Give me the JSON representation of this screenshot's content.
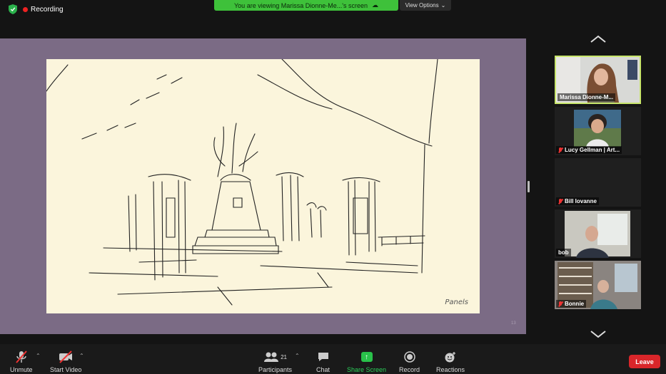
{
  "top": {
    "recording_label": "Recording",
    "banner_text": "You are viewing Marissa Dionne-Me...'s screen",
    "view_options_label": "View Options"
  },
  "share": {
    "slide_caption": "Panels",
    "page_number": "13"
  },
  "participants": [
    {
      "name": "Marissa Dionne-M...",
      "muted": false,
      "active": true
    },
    {
      "name": "Lucy Gellman | Art...",
      "muted": true,
      "active": false
    },
    {
      "name": "Bill Iovanne",
      "muted": true,
      "active": false
    },
    {
      "name": "bob",
      "muted": false,
      "active": false
    },
    {
      "name": "Bonnie",
      "muted": true,
      "active": false
    }
  ],
  "toolbar": {
    "unmute_label": "Unmute",
    "start_video_label": "Start Video",
    "participants_label": "Participants",
    "participants_count": "21",
    "chat_label": "Chat",
    "share_screen_label": "Share Screen",
    "record_label": "Record",
    "reactions_label": "Reactions",
    "leave_label": "Leave"
  },
  "colors": {
    "banner_green": "#3ec13a",
    "active_speaker_border": "#c7e56b",
    "leave_red": "#d9262a",
    "share_green": "#29c14a"
  }
}
